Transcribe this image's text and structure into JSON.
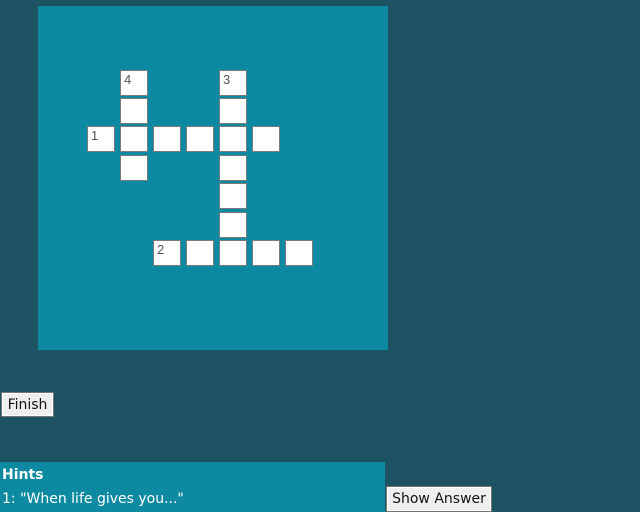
{
  "puzzle": {
    "numbers": {
      "n1": "1",
      "n2": "2",
      "n3": "3",
      "n4": "4"
    }
  },
  "controls": {
    "finish_label": "Finish",
    "show_answer_label": "Show Answer"
  },
  "hints": {
    "title": "Hints",
    "items": [
      {
        "text": "1: \"When life gives you...\""
      }
    ]
  },
  "colors": {
    "page_background": "#1d5263",
    "board_background": "#0d8aa1",
    "cell_background": "#ffffff"
  }
}
